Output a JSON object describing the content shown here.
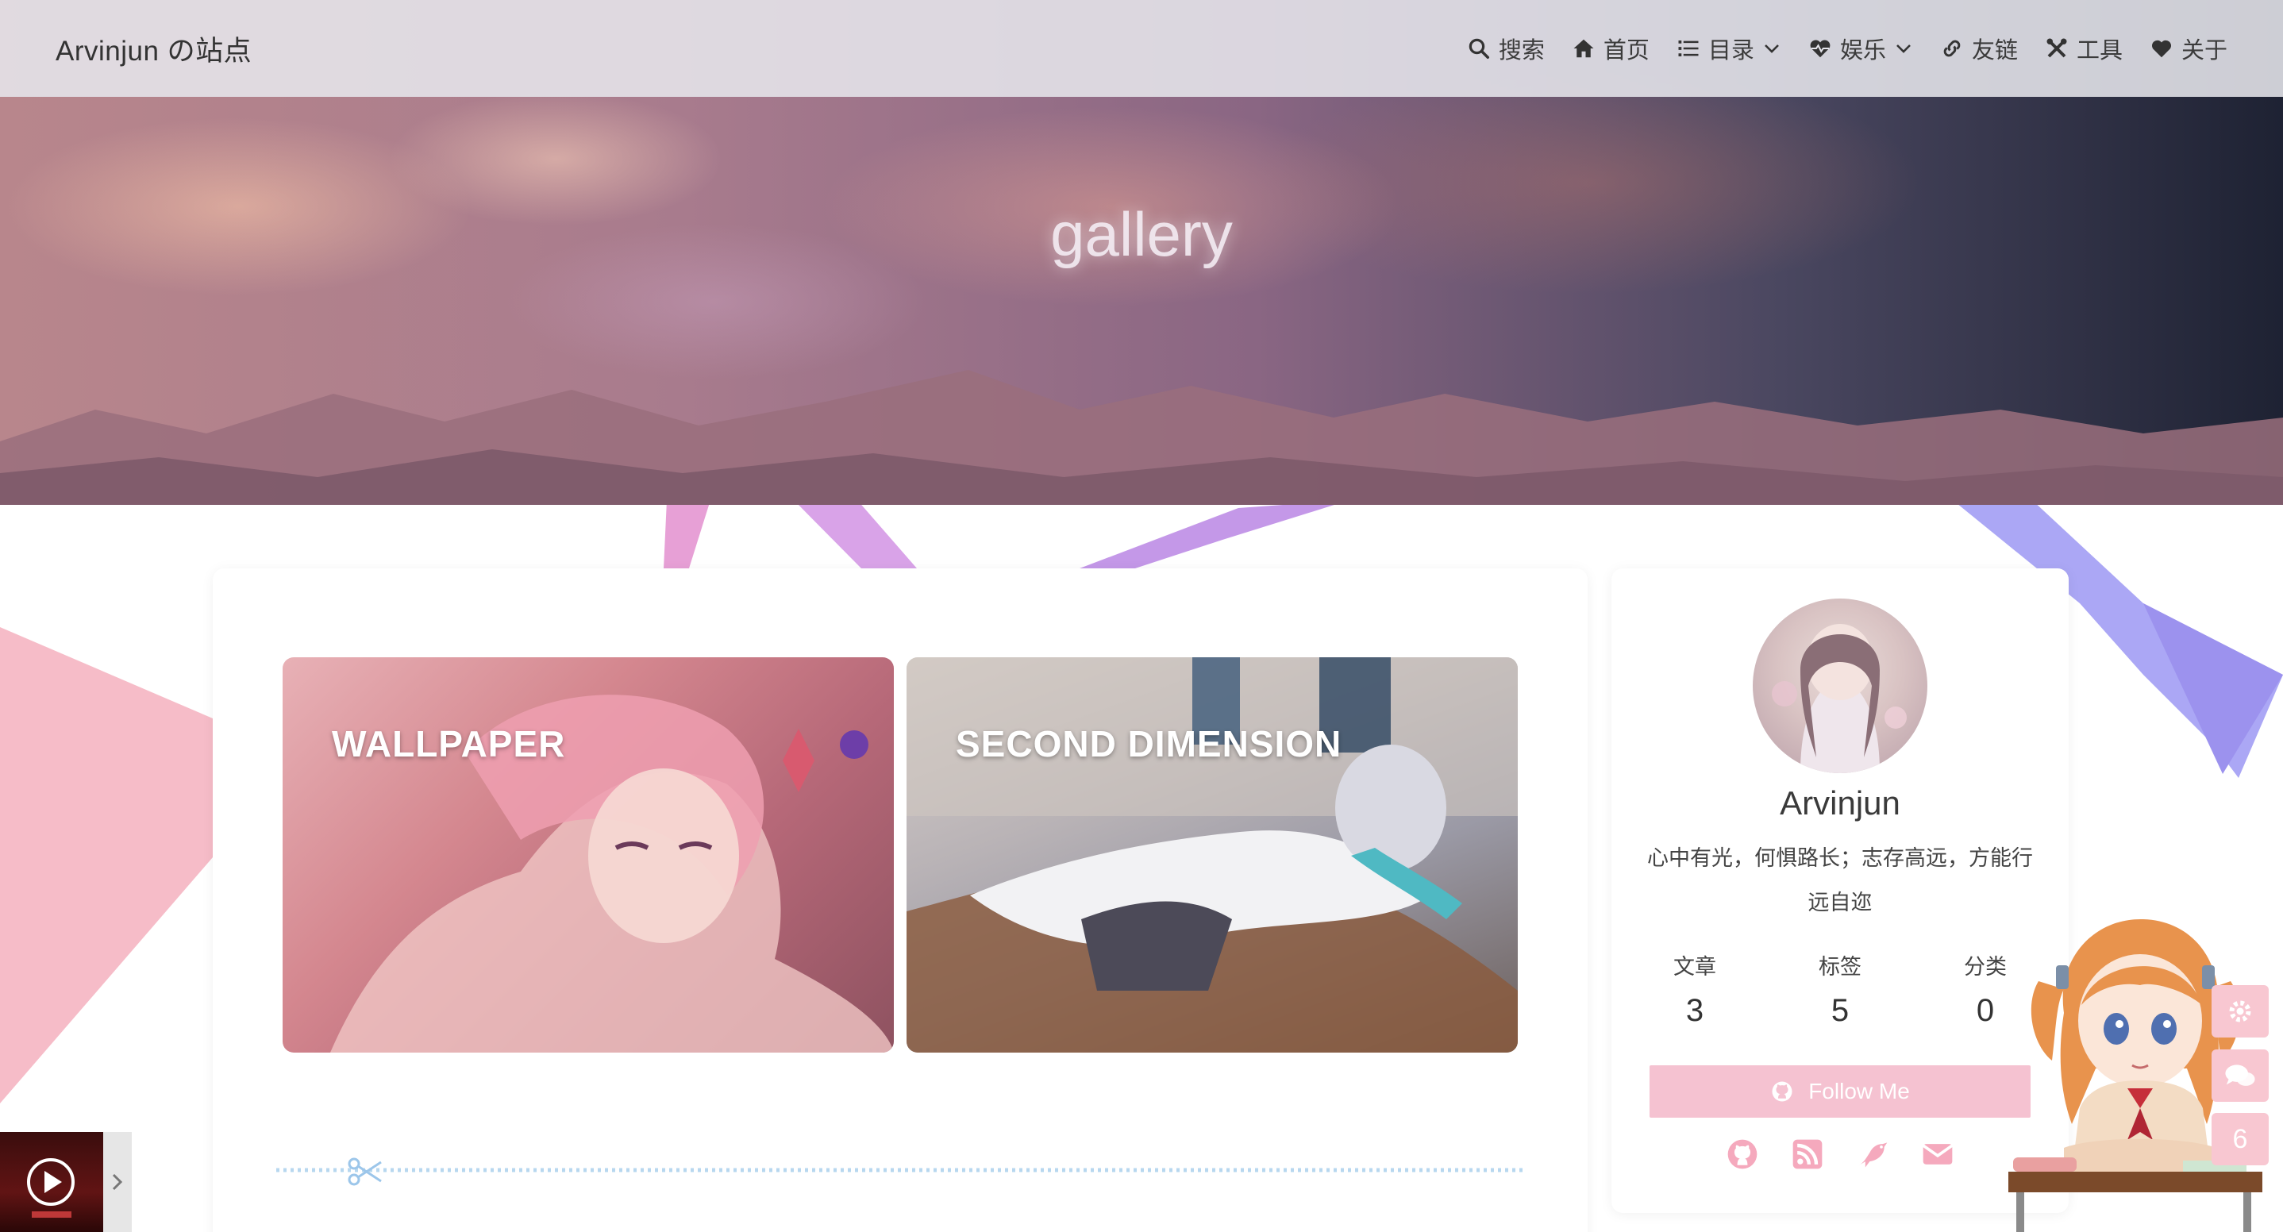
{
  "site": {
    "brand": "Arvinjun の站点"
  },
  "nav": {
    "items": [
      {
        "label": "搜索",
        "icon": "search-icon"
      },
      {
        "label": "首页",
        "icon": "home-icon"
      },
      {
        "label": "目录",
        "icon": "list-icon",
        "dropdown": true
      },
      {
        "label": "娱乐",
        "icon": "heartbeat-icon",
        "dropdown": true
      },
      {
        "label": "友链",
        "icon": "link-icon"
      },
      {
        "label": "工具",
        "icon": "tools-icon"
      },
      {
        "label": "关于",
        "icon": "heart-icon"
      }
    ]
  },
  "page": {
    "title": "gallery"
  },
  "gallery": {
    "items": [
      {
        "label": "WALLPAPER"
      },
      {
        "label": "SECOND DIMENSION"
      }
    ]
  },
  "profile": {
    "name": "Arvinjun",
    "motto": "心中有光，何惧路长；志存高远，方能行远自迩",
    "stats": [
      {
        "label": "文章",
        "value": "3"
      },
      {
        "label": "标签",
        "value": "5"
      },
      {
        "label": "分类",
        "value": "0"
      }
    ],
    "follow_label": "Follow Me",
    "social": [
      "github-icon",
      "rss-icon",
      "bird-icon",
      "mail-icon"
    ]
  },
  "floating": {
    "badge_count": "6"
  },
  "colors": {
    "accent_pink": "#f5c2d1",
    "nav_bg": "#e6e6ec",
    "divider": "#b7d7ef"
  }
}
